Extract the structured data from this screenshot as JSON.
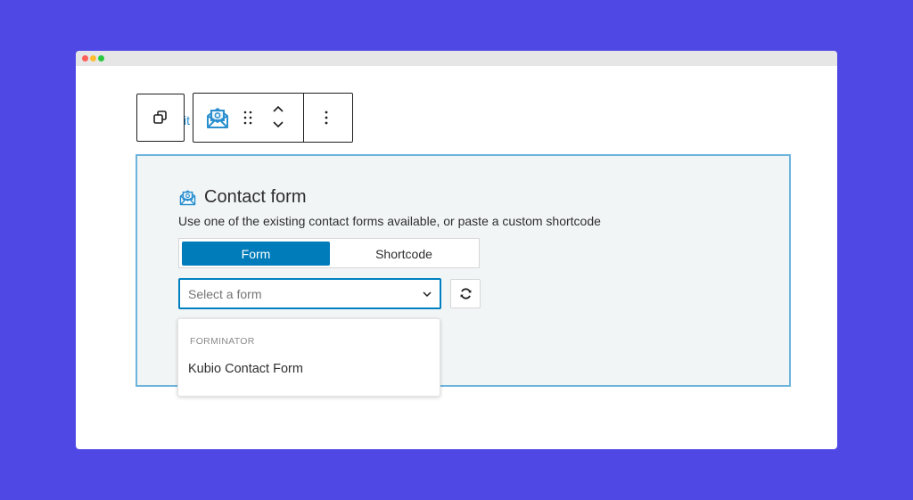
{
  "window": {
    "traffic_lights": [
      "close",
      "minimize",
      "maximize"
    ]
  },
  "block_toolbar": {
    "transform_icon": "duplicate-squares-icon",
    "partial_text": "it",
    "block_icon": "envelope-email-icon",
    "drag_icon": "drag-handle-icon",
    "move_icons": [
      "chevron-up-icon",
      "chevron-down-icon"
    ],
    "options_icon": "more-vertical-icon"
  },
  "contact_block": {
    "title": "Contact form",
    "description": "Use one of the existing contact forms available, or paste a custom shortcode",
    "tabs": [
      {
        "label": "Form",
        "active": true
      },
      {
        "label": "Shortcode",
        "active": false
      }
    ],
    "select": {
      "placeholder": "Select a form",
      "value": ""
    },
    "refresh_icon": "refresh-icon"
  },
  "dropdown": {
    "group_label": "FORMINATOR",
    "options": [
      "Kubio Contact Form"
    ]
  },
  "colors": {
    "background": "#5048e5",
    "accent": "#007cba",
    "block_border": "#6db4dd",
    "block_bg": "#f2f5f6"
  }
}
